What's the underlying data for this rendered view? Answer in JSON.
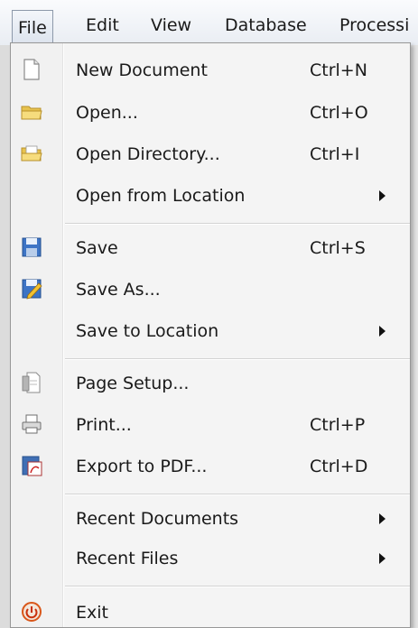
{
  "menubar": {
    "items": [
      {
        "label": "File"
      },
      {
        "label": "Edit"
      },
      {
        "label": "View"
      },
      {
        "label": "Database"
      },
      {
        "label": "Processi"
      }
    ]
  },
  "file_menu": {
    "items": [
      {
        "label": "New Document",
        "shortcut": "Ctrl+N",
        "icon": "new-document-icon"
      },
      {
        "label": "Open...",
        "shortcut": "Ctrl+O",
        "icon": "folder-open-icon"
      },
      {
        "label": "Open Directory...",
        "shortcut": "Ctrl+I",
        "icon": "open-directory-icon"
      },
      {
        "label": "Open from Location",
        "icon": "none"
      },
      {
        "label": "Save",
        "shortcut": "Ctrl+S",
        "icon": "save-icon"
      },
      {
        "label": "Save As...",
        "icon": "save-as-icon"
      },
      {
        "label": "Save to Location",
        "icon": "none"
      },
      {
        "label": "Page Setup...",
        "icon": "page-setup-icon"
      },
      {
        "label": "Print...",
        "shortcut": "Ctrl+P",
        "icon": "printer-icon"
      },
      {
        "label": "Export to PDF...",
        "shortcut": "Ctrl+D",
        "icon": "pdf-icon"
      },
      {
        "label": "Recent Documents",
        "icon": "none"
      },
      {
        "label": "Recent Files",
        "icon": "none"
      },
      {
        "label": "Exit",
        "icon": "exit-icon"
      }
    ]
  },
  "colors": {
    "menu_background": "#f4f4f4",
    "menubar_background": "#eef1f6",
    "active_border": "#8d99aa",
    "text": "#1a1a1a"
  }
}
